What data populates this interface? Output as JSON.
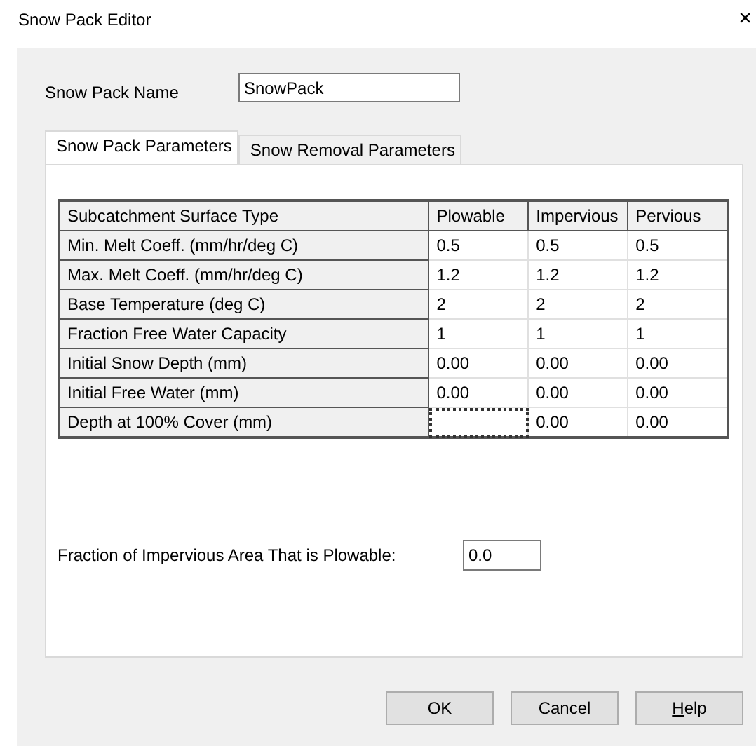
{
  "window": {
    "title": "Snow Pack Editor",
    "close": "×"
  },
  "name_field": {
    "label": "Snow Pack Name",
    "value": "SnowPack"
  },
  "tabs": [
    {
      "label": "Snow Pack Parameters",
      "selected": true
    },
    {
      "label": "Snow Removal Parameters",
      "selected": false
    }
  ],
  "table": {
    "columns": [
      "Subcatchment Surface Type",
      "Plowable",
      "Impervious",
      "Pervious"
    ],
    "rows": [
      {
        "cells": [
          {
            "value": "Min. Melt Coeff. (mm/hr/deg C)",
            "focused": false
          },
          {
            "value": "0.5",
            "focused": false
          },
          {
            "value": "0.5",
            "focused": false
          },
          {
            "value": "0.5",
            "focused": false
          }
        ]
      },
      {
        "cells": [
          {
            "value": "Max. Melt Coeff. (mm/hr/deg C)",
            "focused": false
          },
          {
            "value": "1.2",
            "focused": false
          },
          {
            "value": "1.2",
            "focused": false
          },
          {
            "value": "1.2",
            "focused": false
          }
        ]
      },
      {
        "cells": [
          {
            "value": "Base Temperature (deg C)",
            "focused": false
          },
          {
            "value": "2",
            "focused": false
          },
          {
            "value": "2",
            "focused": false
          },
          {
            "value": "2",
            "focused": false
          }
        ]
      },
      {
        "cells": [
          {
            "value": "Fraction Free Water Capacity",
            "focused": false
          },
          {
            "value": "1",
            "focused": false
          },
          {
            "value": "1",
            "focused": false
          },
          {
            "value": "1",
            "focused": false
          }
        ]
      },
      {
        "cells": [
          {
            "value": "Initial Snow Depth (mm)",
            "focused": false
          },
          {
            "value": "0.00",
            "focused": false
          },
          {
            "value": "0.00",
            "focused": false
          },
          {
            "value": "0.00",
            "focused": false
          }
        ]
      },
      {
        "cells": [
          {
            "value": "Initial Free Water (mm)",
            "focused": false
          },
          {
            "value": "0.00",
            "focused": false
          },
          {
            "value": "0.00",
            "focused": false
          },
          {
            "value": "0.00",
            "focused": false
          }
        ]
      },
      {
        "cells": [
          {
            "value": "Depth at 100% Cover (mm)",
            "focused": false
          },
          {
            "focused": true
          },
          {
            "value": "0.00",
            "focused": false
          },
          {
            "value": "0.00",
            "focused": false
          }
        ]
      }
    ]
  },
  "fraction_field": {
    "label": "Fraction of Impervious Area That is Plowable:",
    "value": "0.0"
  },
  "buttons": [
    {
      "label": "OK",
      "mnemonic": false
    },
    {
      "label": "Cancel",
      "mnemonic": false
    },
    {
      "label": "Help",
      "mnemonic": true
    }
  ]
}
